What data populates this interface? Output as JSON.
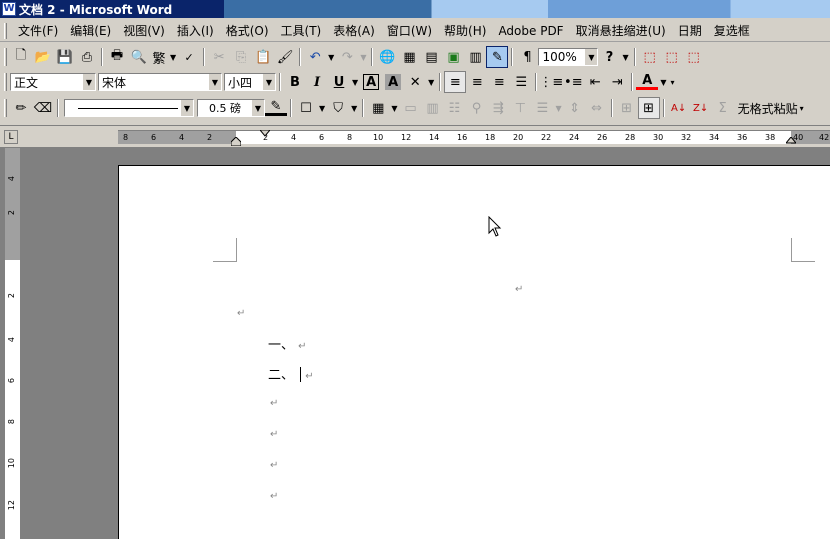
{
  "window": {
    "title": "文档 2 - Microsoft Word",
    "app_icon": "W"
  },
  "menu": [
    "文件(F)",
    "编辑(E)",
    "视图(V)",
    "插入(I)",
    "格式(O)",
    "工具(T)",
    "表格(A)",
    "窗口(W)",
    "帮助(H)",
    "Adobe PDF",
    "取消悬挂缩进(U)",
    "日期",
    "复选框"
  ],
  "standard_toolbar": {
    "font_kind_label": "繁",
    "zoom": "100%"
  },
  "format_toolbar": {
    "style": "正文",
    "font": "宋体",
    "size": "小四",
    "bold": "B",
    "italic": "I",
    "underline": "U",
    "char_border": "A",
    "char_shade": "A",
    "font_color": "A"
  },
  "drawing_toolbar": {
    "line_weight": "0.5 磅",
    "paste_plain": "无格式粘贴",
    "sigma": "Σ"
  },
  "ruler": {
    "corner": "L",
    "h_ticks": [
      "8",
      "6",
      "4",
      "2",
      "2",
      "4",
      "6",
      "8",
      "10",
      "12",
      "14",
      "16",
      "18",
      "20",
      "22",
      "24",
      "26",
      "28",
      "30",
      "32",
      "34",
      "36",
      "38",
      "40",
      "42"
    ],
    "v_ticks": [
      "4",
      "2",
      "2",
      "4",
      "6",
      "8",
      "10",
      "12"
    ]
  },
  "document": {
    "lines": [
      "一、",
      "二、"
    ],
    "paragraph_mark": "↵"
  }
}
